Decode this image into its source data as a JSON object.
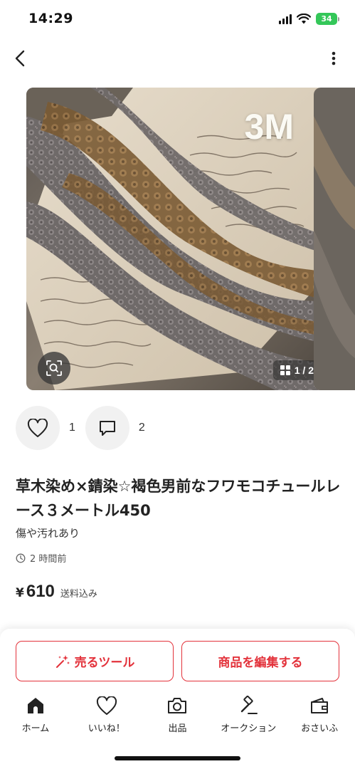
{
  "status_bar": {
    "time": "14:29",
    "battery": "34"
  },
  "gallery": {
    "photo_label": "3M",
    "page_indicator": "1 / 2"
  },
  "social": {
    "likes": "1",
    "comments": "2"
  },
  "product": {
    "title": "草木染め×錆染☆褐色男前なフワモコチュールレース３メートル450",
    "condition": "傷や汚れあり",
    "posted": "2 時間前",
    "currency": "¥",
    "price": "610",
    "shipping": "送料込み"
  },
  "actions": {
    "sell_tool": "売るツール",
    "edit": "商品を編集する"
  },
  "tabs": [
    {
      "label": "ホーム",
      "icon": "home-icon",
      "active": true
    },
    {
      "label": "いいね！",
      "icon": "heart-icon"
    },
    {
      "label": "出品",
      "icon": "camera-icon"
    },
    {
      "label": "オークション",
      "icon": "gavel-icon"
    },
    {
      "label": "おさいふ",
      "icon": "wallet-icon"
    }
  ],
  "colors": {
    "accent": "#e3323b",
    "battery": "#34c759"
  }
}
